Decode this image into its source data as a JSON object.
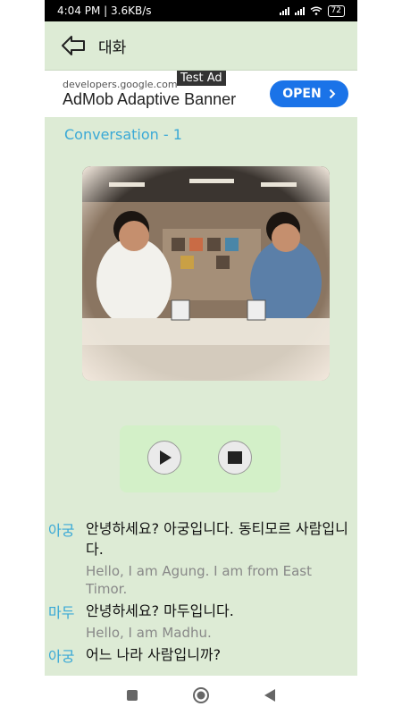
{
  "status_bar": {
    "time": "4:04 PM | 3.6KB/s",
    "battery": "72"
  },
  "app_bar": {
    "title": "대화",
    "back_icon": "back-arrow-icon"
  },
  "ad": {
    "url": "developers.google.com",
    "title": "AdMob Adaptive Banner",
    "badge": "Test Ad",
    "open_label": "OPEN"
  },
  "conversation_title": "Conversation - 1",
  "player": {
    "play_icon": "play-icon",
    "stop_icon": "stop-icon"
  },
  "lines": [
    {
      "speaker": "아궁",
      "korean": "안녕하세요? 아궁입니다. 동티모르 사람입니다.",
      "english": "Hello, I am Agung. I am from East Timor."
    },
    {
      "speaker": "마두",
      "korean": "안녕하세요? 마두입니다.",
      "english": "Hello, I am Madhu."
    },
    {
      "speaker": "아궁",
      "korean": "어느 나라 사람입니까?",
      "english": ""
    }
  ],
  "colors": {
    "background": "#ddebd5",
    "accent": "#3aa9d6",
    "player_bg": "#d3f0c8",
    "ad_button": "#1a73e8"
  }
}
